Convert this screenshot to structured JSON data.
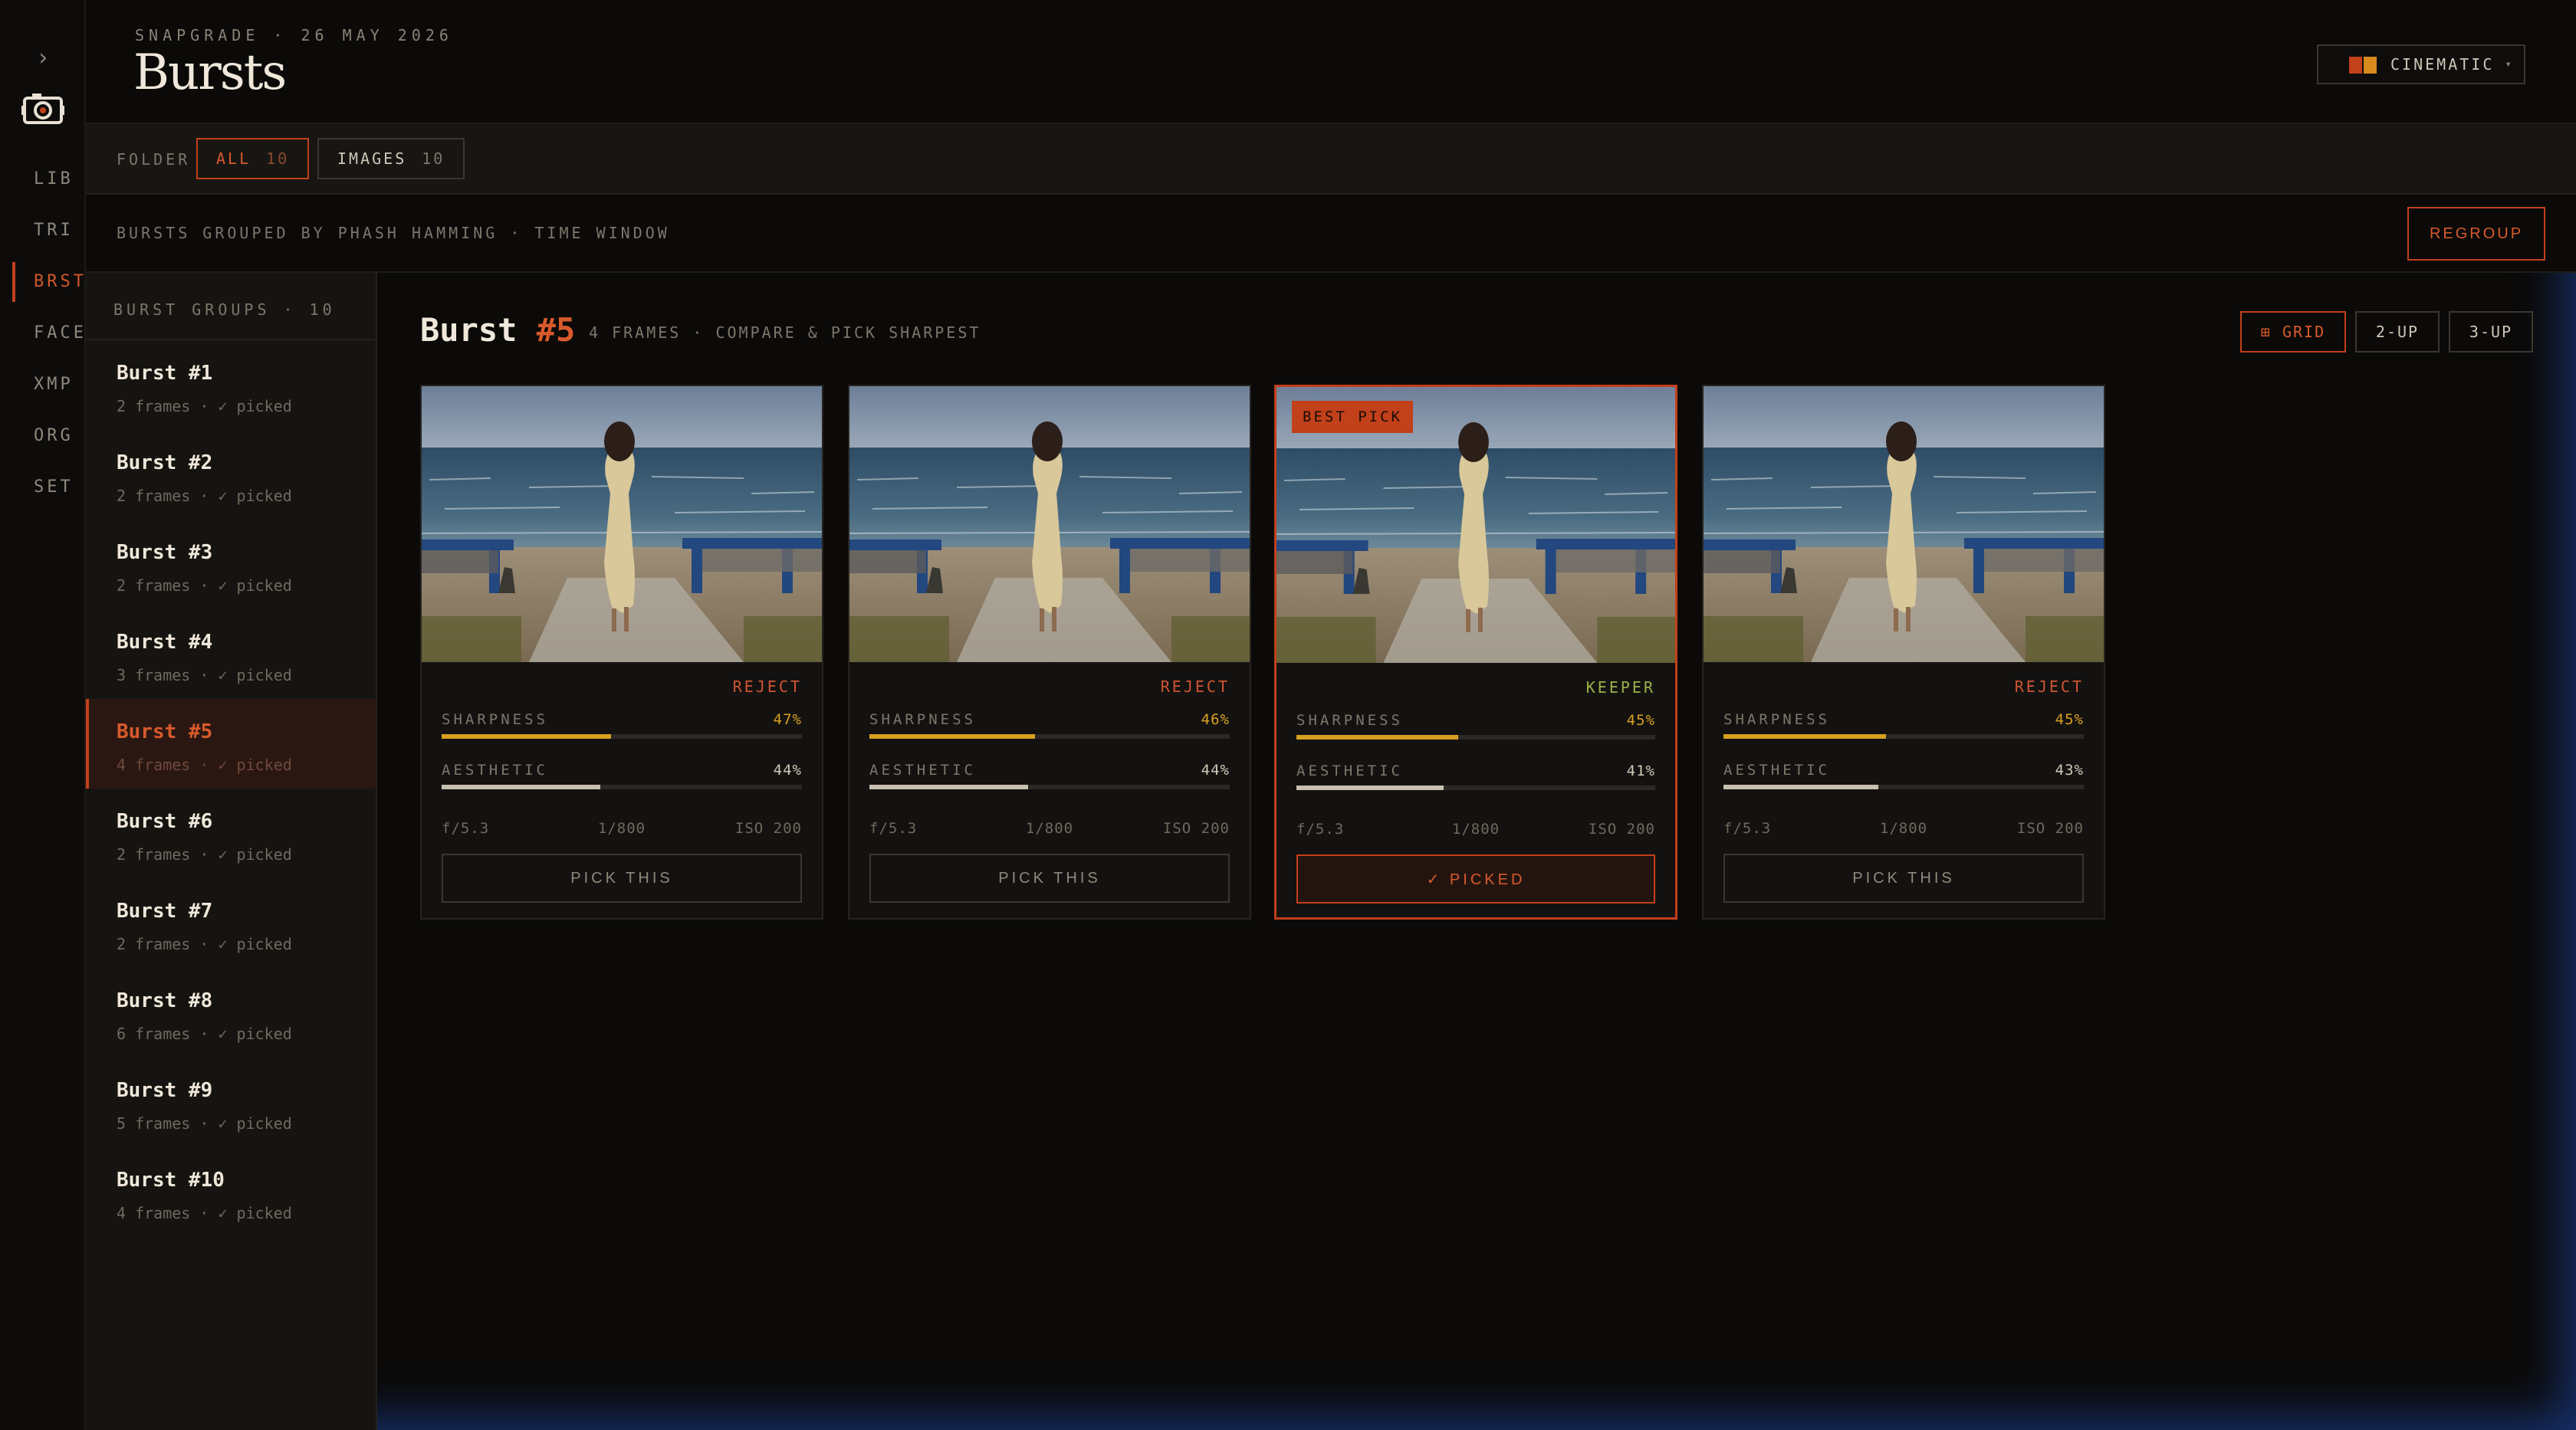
{
  "header": {
    "meta": "SNAPGRADE · 26 MAY 2026",
    "title": "Bursts",
    "theme_label": "CINEMATIC",
    "theme_caret": "▾",
    "theme_colors": [
      "#c2401a",
      "#d88a1c"
    ]
  },
  "rail": {
    "expand_glyph": "›",
    "items": [
      {
        "label": "LIB"
      },
      {
        "label": "TRI"
      },
      {
        "label": "BRST"
      },
      {
        "label": "FACE"
      },
      {
        "label": "XMP"
      },
      {
        "label": "ORG"
      },
      {
        "label": "SET"
      }
    ]
  },
  "folderbar": {
    "label": "FOLDER",
    "chips": [
      {
        "label": "ALL",
        "count": "10"
      },
      {
        "label": "IMAGES",
        "count": "10"
      }
    ]
  },
  "infobar": {
    "text": "BURSTS GROUPED BY PHASH HAMMING · TIME WINDOW",
    "regroup_label": "REGROUP"
  },
  "groups": {
    "header": "BURST GROUPS · 10",
    "items": [
      {
        "name": "Burst #1",
        "sub": "2 frames · ✓ picked"
      },
      {
        "name": "Burst #2",
        "sub": "2 frames · ✓ picked"
      },
      {
        "name": "Burst #3",
        "sub": "2 frames · ✓ picked"
      },
      {
        "name": "Burst #4",
        "sub": "3 frames · ✓ picked"
      },
      {
        "name": "Burst #5",
        "sub": "4 frames · ✓ picked"
      },
      {
        "name": "Burst #6",
        "sub": "2 frames · ✓ picked"
      },
      {
        "name": "Burst #7",
        "sub": "2 frames · ✓ picked"
      },
      {
        "name": "Burst #8",
        "sub": "6 frames · ✓ picked"
      },
      {
        "name": "Burst #9",
        "sub": "5 frames · ✓ picked"
      },
      {
        "name": "Burst #10",
        "sub": "4 frames · ✓ picked"
      }
    ]
  },
  "main": {
    "title_prefix": "Burst ",
    "title_num": "#5",
    "subtitle": "4 FRAMES · COMPARE & PICK SHARPEST",
    "view_buttons": [
      {
        "label": "⊞ GRID"
      },
      {
        "label": "2-UP"
      },
      {
        "label": "3-UP"
      }
    ],
    "frames": [
      {
        "verdict": "REJECT",
        "sharpness_label": "SHARPNESS",
        "sharpness": "47%",
        "sharpness_value": 0.47,
        "aesthetic_label": "AESTHETIC",
        "aesthetic": "44%",
        "aesthetic_value": 0.44,
        "aperture": "f/5.3",
        "shutter": "1/800",
        "iso": "ISO 200",
        "button": "PICK THIS"
      },
      {
        "verdict": "REJECT",
        "sharpness_label": "SHARPNESS",
        "sharpness": "46%",
        "sharpness_value": 0.46,
        "aesthetic_label": "AESTHETIC",
        "aesthetic": "44%",
        "aesthetic_value": 0.44,
        "aperture": "f/5.3",
        "shutter": "1/800",
        "iso": "ISO 200",
        "button": "PICK THIS"
      },
      {
        "badge": "BEST PICK",
        "verdict": "KEEPER",
        "sharpness_label": "SHARPNESS",
        "sharpness": "45%",
        "sharpness_value": 0.45,
        "aesthetic_label": "AESTHETIC",
        "aesthetic": "41%",
        "aesthetic_value": 0.41,
        "aperture": "f/5.3",
        "shutter": "1/800",
        "iso": "ISO 200",
        "button": "✓ PICKED"
      },
      {
        "verdict": "REJECT",
        "sharpness_label": "SHARPNESS",
        "sharpness": "45%",
        "sharpness_value": 0.45,
        "aesthetic_label": "AESTHETIC",
        "aesthetic": "43%",
        "aesthetic_value": 0.43,
        "aperture": "f/5.3",
        "shutter": "1/800",
        "iso": "ISO 200",
        "button": "PICK THIS"
      }
    ]
  },
  "colors": {
    "accent": "#c2401a",
    "sharpness_bar": "#d8a020",
    "aesthetic_bar": "#c8c0b0",
    "reject": "#cf5532",
    "keeper": "#9cb04a"
  }
}
